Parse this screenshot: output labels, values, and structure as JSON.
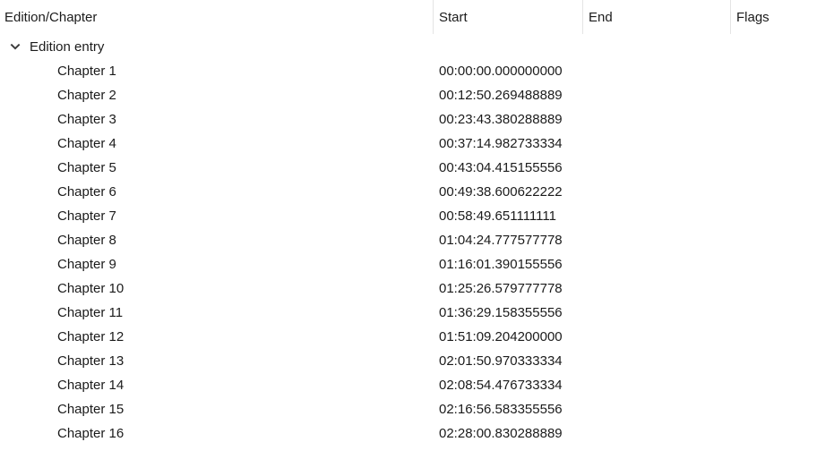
{
  "columns": [
    {
      "key": "name",
      "label": "Edition/Chapter"
    },
    {
      "key": "start",
      "label": "Start"
    },
    {
      "key": "end",
      "label": "End"
    },
    {
      "key": "flags",
      "label": "Flags"
    }
  ],
  "tree": {
    "root": {
      "label": "Edition entry",
      "expanded": true,
      "expander_icon": "chevron-down-icon",
      "start": "",
      "end": "",
      "flags": ""
    },
    "children": [
      {
        "label": "Chapter 1",
        "start": "00:00:00.000000000",
        "end": "",
        "flags": ""
      },
      {
        "label": "Chapter 2",
        "start": "00:12:50.269488889",
        "end": "",
        "flags": ""
      },
      {
        "label": "Chapter 3",
        "start": "00:23:43.380288889",
        "end": "",
        "flags": ""
      },
      {
        "label": "Chapter 4",
        "start": "00:37:14.982733334",
        "end": "",
        "flags": ""
      },
      {
        "label": "Chapter 5",
        "start": "00:43:04.415155556",
        "end": "",
        "flags": ""
      },
      {
        "label": "Chapter 6",
        "start": "00:49:38.600622222",
        "end": "",
        "flags": ""
      },
      {
        "label": "Chapter 7",
        "start": "00:58:49.651111111",
        "end": "",
        "flags": ""
      },
      {
        "label": "Chapter 8",
        "start": "01:04:24.777577778",
        "end": "",
        "flags": ""
      },
      {
        "label": "Chapter 9",
        "start": "01:16:01.390155556",
        "end": "",
        "flags": ""
      },
      {
        "label": "Chapter 10",
        "start": "01:25:26.579777778",
        "end": "",
        "flags": ""
      },
      {
        "label": "Chapter 11",
        "start": "01:36:29.158355556",
        "end": "",
        "flags": ""
      },
      {
        "label": "Chapter 12",
        "start": "01:51:09.204200000",
        "end": "",
        "flags": ""
      },
      {
        "label": "Chapter 13",
        "start": "02:01:50.970333334",
        "end": "",
        "flags": ""
      },
      {
        "label": "Chapter 14",
        "start": "02:08:54.476733334",
        "end": "",
        "flags": ""
      },
      {
        "label": "Chapter 15",
        "start": "02:16:56.583355556",
        "end": "",
        "flags": ""
      },
      {
        "label": "Chapter 16",
        "start": "02:28:00.830288889",
        "end": "",
        "flags": ""
      }
    ]
  },
  "colors": {
    "background": "#ffffff",
    "text": "#1b1b1b",
    "divider": "#e4e4e4",
    "chevron": "#3a3a3a"
  }
}
